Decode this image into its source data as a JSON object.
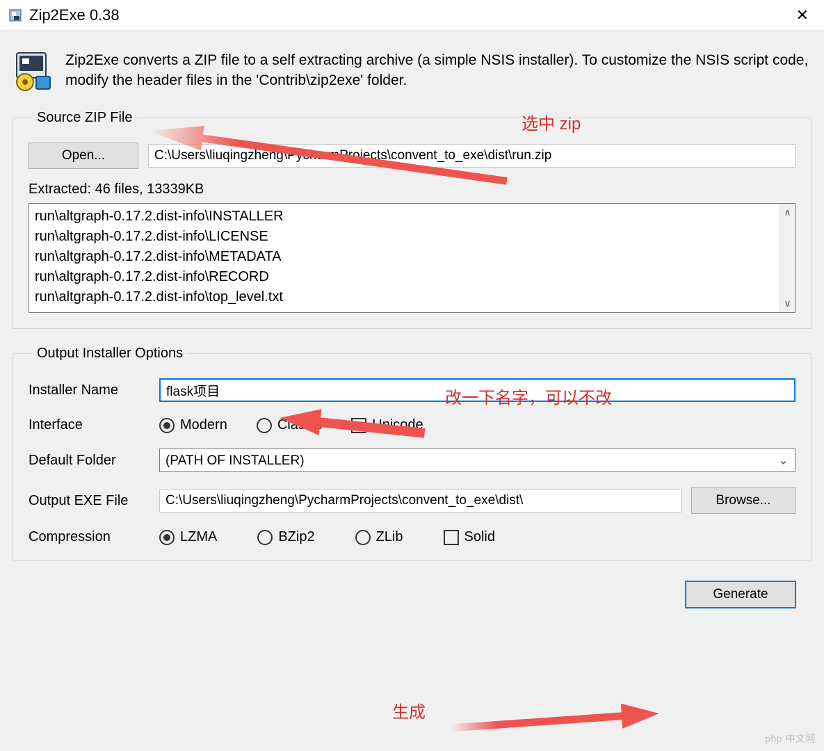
{
  "window": {
    "title": "Zip2Exe 0.38",
    "close_glyph": "✕"
  },
  "intro": {
    "text": "Zip2Exe converts a ZIP file to a self extracting archive (a simple NSIS installer). To customize the NSIS script code, modify the header files in the 'Contrib\\zip2exe' folder."
  },
  "source": {
    "legend": "Source ZIP File",
    "open_label": "Open...",
    "zip_path": "C:\\Users\\liuqingzheng\\PycharmProjects\\convent_to_exe\\dist\\run.zip",
    "extracted_label": "Extracted: 46 files, 13339KB",
    "files": [
      "run\\altgraph-0.17.2.dist-info\\INSTALLER",
      "run\\altgraph-0.17.2.dist-info\\LICENSE",
      "run\\altgraph-0.17.2.dist-info\\METADATA",
      "run\\altgraph-0.17.2.dist-info\\RECORD",
      "run\\altgraph-0.17.2.dist-info\\top_level.txt"
    ]
  },
  "output": {
    "legend": "Output Installer Options",
    "installer_name_label": "Installer Name",
    "installer_name_value": "flask项目",
    "interface_label": "Interface",
    "interface_options": {
      "modern": "Modern",
      "classic": "Classic",
      "unicode": "Unicode"
    },
    "interface_selected": "modern",
    "unicode_checked": true,
    "default_folder_label": "Default Folder",
    "default_folder_value": "(PATH OF INSTALLER)",
    "output_exe_label": "Output EXE File",
    "output_exe_value": "C:\\Users\\liuqingzheng\\PycharmProjects\\convent_to_exe\\dist\\",
    "browse_label": "Browse...",
    "compression_label": "Compression",
    "compression_options": {
      "lzma": "LZMA",
      "bzip2": "BZip2",
      "zlib": "ZLib",
      "solid": "Solid"
    },
    "compression_selected": "lzma",
    "solid_checked": false
  },
  "footer": {
    "generate_label": "Generate"
  },
  "annotations": {
    "select_zip": "选中 zip",
    "rename": "改一下名字，可以不改",
    "generate": "生成"
  },
  "watermark": "php 中文网"
}
